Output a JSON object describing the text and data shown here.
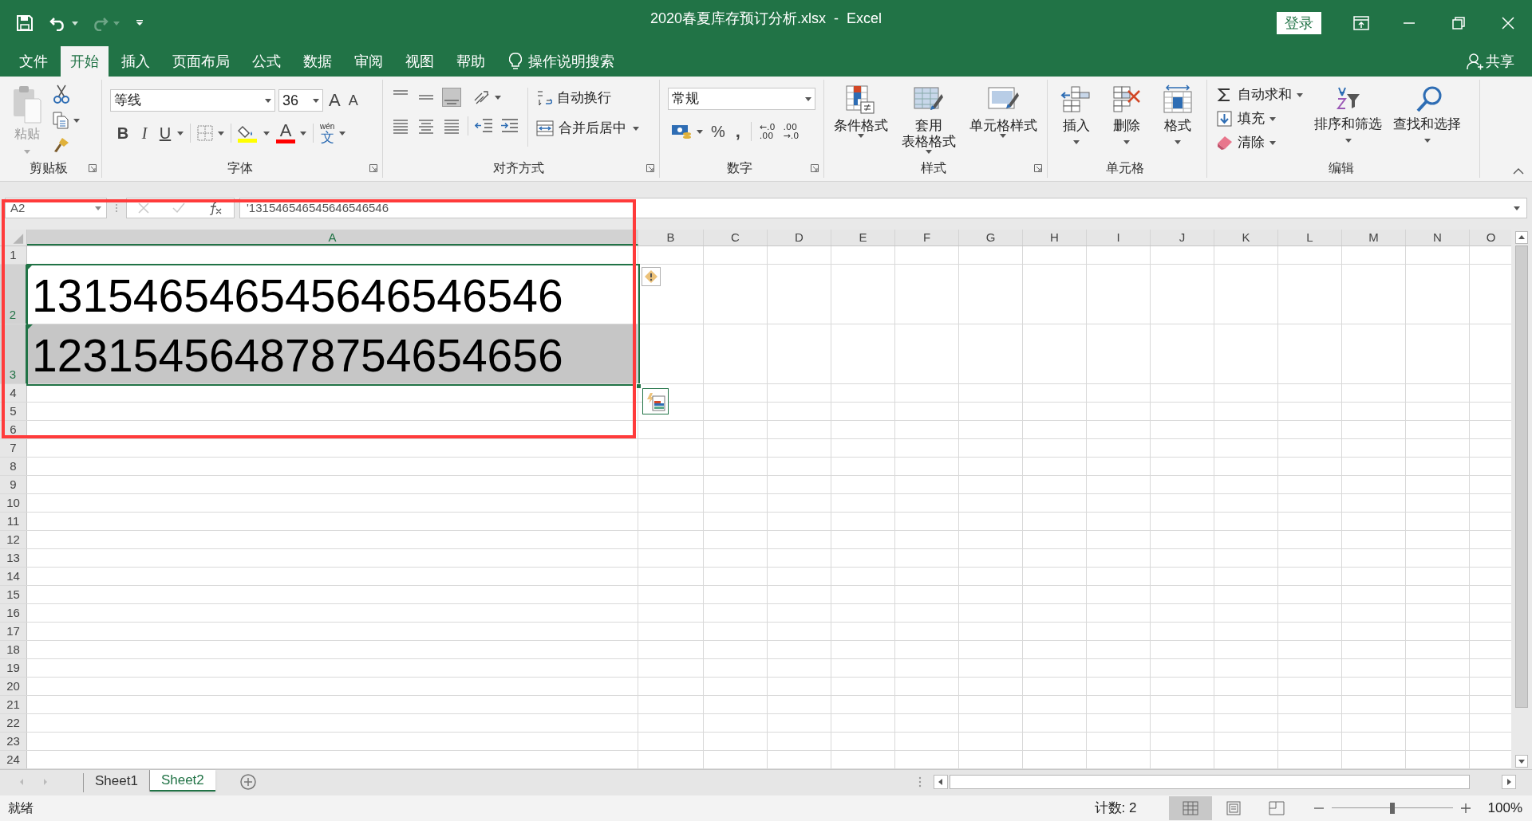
{
  "title_bar": {
    "title": "2020春夏库存预订分析.xlsx  -  Excel",
    "login_button": "登录"
  },
  "ribbon_tabs": [
    {
      "label": "文件",
      "selected": false
    },
    {
      "label": "开始",
      "selected": true
    },
    {
      "label": "插入",
      "selected": false
    },
    {
      "label": "页面布局",
      "selected": false
    },
    {
      "label": "公式",
      "selected": false
    },
    {
      "label": "数据",
      "selected": false
    },
    {
      "label": "审阅",
      "selected": false
    },
    {
      "label": "视图",
      "selected": false
    },
    {
      "label": "帮助",
      "selected": false
    }
  ],
  "tell_me": "操作说明搜索",
  "share": "共享",
  "clipboard": {
    "paste": "粘贴",
    "label": "剪贴板"
  },
  "font": {
    "name": "等线",
    "size": "36",
    "grow": "A",
    "shrink": "A",
    "bold": "B",
    "italic": "I",
    "underline": "U",
    "color_letter": "A",
    "phonetic_top": "wén",
    "phonetic": "文",
    "label": "字体"
  },
  "alignment": {
    "wrap": "自动换行",
    "merge": "合并后居中",
    "label": "对齐方式"
  },
  "number": {
    "format": "常规",
    "percent": "%",
    "comma": ",",
    "increase_decimal": [
      "←.0",
      ".00"
    ],
    "decrease_decimal": [
      ".00",
      "→.0"
    ],
    "label": "数字"
  },
  "styles": {
    "buttons": [
      {
        "kind": "conditional",
        "lines": [
          "条件格式"
        ]
      },
      {
        "kind": "table",
        "lines": [
          "套用",
          "表格格式"
        ]
      },
      {
        "kind": "cell_styles",
        "lines": [
          "单元格样式"
        ]
      }
    ],
    "label": "样式"
  },
  "cells": {
    "buttons": [
      {
        "kind": "insert",
        "label": "插入"
      },
      {
        "kind": "delete",
        "label": "删除"
      },
      {
        "kind": "format",
        "label": "格式"
      }
    ],
    "label": "单元格"
  },
  "editing": {
    "small": [
      {
        "kind": "autosum",
        "label": "自动求和"
      },
      {
        "kind": "fill",
        "label": "填充"
      },
      {
        "kind": "clear",
        "label": "清除"
      }
    ],
    "big": [
      {
        "kind": "sort",
        "label": "排序和筛选"
      },
      {
        "kind": "find",
        "label": "查找和选择"
      }
    ],
    "label": "编辑"
  },
  "formula_bar": {
    "name_box": "A2",
    "content": "'131546546545646546546"
  },
  "sheet": {
    "columns": [
      {
        "label": "A",
        "selected": true
      },
      {
        "label": "B",
        "selected": false
      },
      {
        "label": "C",
        "selected": false
      },
      {
        "label": "D",
        "selected": false
      },
      {
        "label": "E",
        "selected": false
      },
      {
        "label": "F",
        "selected": false
      },
      {
        "label": "G",
        "selected": false
      },
      {
        "label": "H",
        "selected": false
      },
      {
        "label": "I",
        "selected": false
      },
      {
        "label": "J",
        "selected": false
      },
      {
        "label": "K",
        "selected": false
      },
      {
        "label": "L",
        "selected": false
      },
      {
        "label": "M",
        "selected": false
      },
      {
        "label": "N",
        "selected": false
      },
      {
        "label": "O",
        "selected": false
      }
    ],
    "rows": [
      {
        "label": "1",
        "selected": false
      },
      {
        "label": "2",
        "selected": true,
        "value": "131546546545646546546",
        "active": true,
        "error_flag": true
      },
      {
        "label": "3",
        "selected": true,
        "value": "123154564878754654656",
        "active": false,
        "error_flag": true
      },
      {
        "label": "4",
        "selected": false
      },
      {
        "label": "5",
        "selected": false
      },
      {
        "label": "6",
        "selected": false
      },
      {
        "label": "7",
        "selected": false
      },
      {
        "label": "8",
        "selected": false
      },
      {
        "label": "9",
        "selected": false
      },
      {
        "label": "10",
        "selected": false
      },
      {
        "label": "11",
        "selected": false
      },
      {
        "label": "12",
        "selected": false
      },
      {
        "label": "13",
        "selected": false
      },
      {
        "label": "14",
        "selected": false
      },
      {
        "label": "15",
        "selected": false
      },
      {
        "label": "16",
        "selected": false
      },
      {
        "label": "17",
        "selected": false
      },
      {
        "label": "18",
        "selected": false
      },
      {
        "label": "19",
        "selected": false
      },
      {
        "label": "20",
        "selected": false
      },
      {
        "label": "21",
        "selected": false
      },
      {
        "label": "22",
        "selected": false
      },
      {
        "label": "23",
        "selected": false
      },
      {
        "label": "24",
        "selected": false
      }
    ]
  },
  "sheet_tabs": [
    {
      "label": "Sheet1",
      "selected": false
    },
    {
      "label": "Sheet2",
      "selected": true
    }
  ],
  "status_bar": {
    "ready": "就绪",
    "count": "计数: 2",
    "views": [
      {
        "kind": "normal",
        "selected": true
      },
      {
        "kind": "page_layout",
        "selected": false
      },
      {
        "kind": "page_break",
        "selected": false
      }
    ],
    "zoom": {
      "level": 0.5
    },
    "zoom_text": "100%"
  }
}
